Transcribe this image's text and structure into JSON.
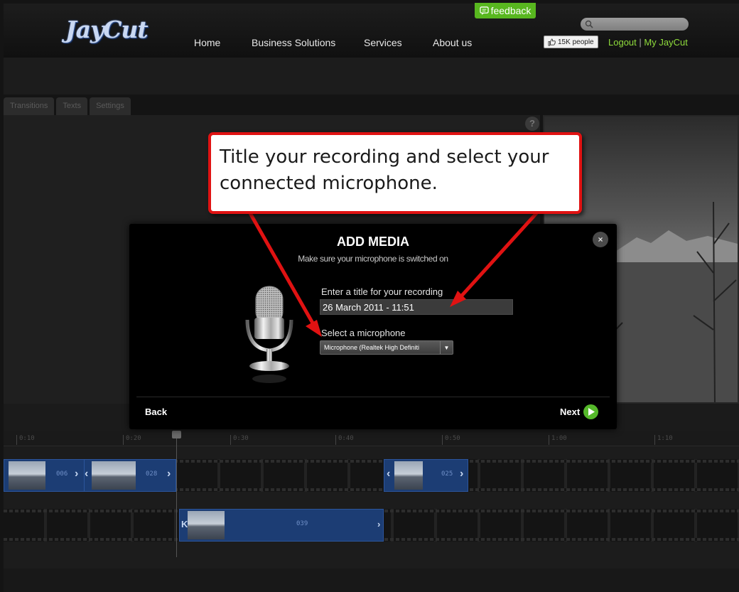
{
  "header": {
    "logo_text": "JayCut",
    "nav": [
      "Home",
      "Business Solutions",
      "Services",
      "About us"
    ],
    "feedback_label": "feedback",
    "search_placeholder": "",
    "like_label": "15K people",
    "logout_label": "Logout",
    "separator": "|",
    "my_account_label": "My JayCut"
  },
  "editor": {
    "tabs": [
      "Transitions",
      "Texts",
      "Settings"
    ],
    "help_label": "?",
    "ruler_ticks": [
      "0:10",
      "0:20",
      "0:30",
      "0:40",
      "0:50",
      "1:00",
      "1:10"
    ],
    "track1_clips": [
      "006",
      "028",
      "025"
    ],
    "track2_clips": [
      "039"
    ]
  },
  "modal": {
    "title": "ADD MEDIA",
    "subtitle": "Make sure your microphone is switched on",
    "title_field_label": "Enter a title for your recording",
    "title_field_value": "26 March 2011 - 11:51",
    "mic_field_label": "Select a microphone",
    "mic_selected": "Microphone (Realtek High Definiti",
    "close_label": "×",
    "back_label": "Back",
    "next_label": "Next"
  },
  "callout": {
    "text": "Title your recording and select your connected microphone."
  },
  "colors": {
    "accent_green": "#58b71f",
    "link_green": "#8fdc3c",
    "callout_red": "#e01212",
    "clip_blue": "#1c3d74"
  },
  "icons": [
    "search-icon",
    "thumbs-up-icon",
    "chat-bubble-icon",
    "close-icon",
    "microphone-icon",
    "play-arrow-icon",
    "help-icon",
    "chevron-icon"
  ]
}
